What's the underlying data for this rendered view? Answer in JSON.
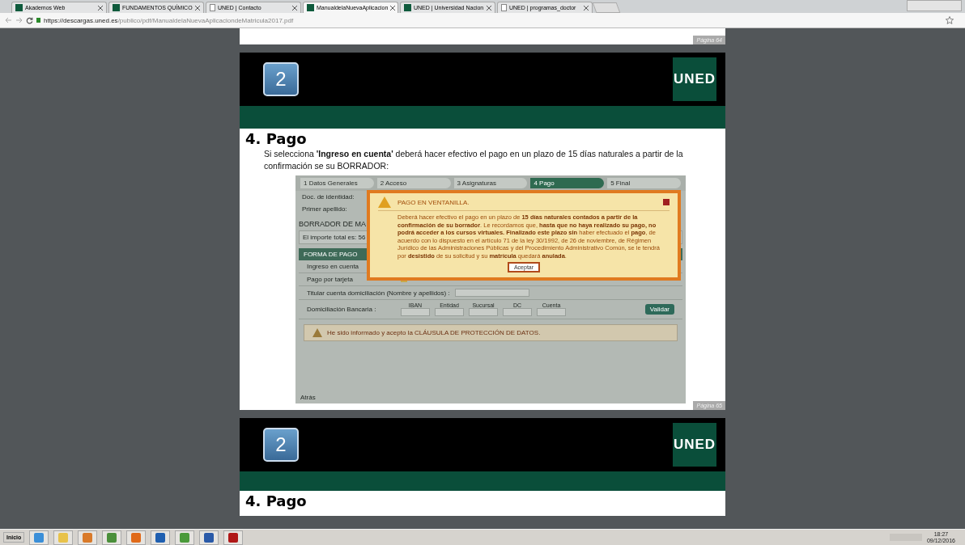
{
  "tabs": [
    {
      "label": "Akademos Web",
      "selected": false,
      "kind": "site"
    },
    {
      "label": "FUNDAMENTOS QUÍMICO",
      "selected": false,
      "kind": "site"
    },
    {
      "label": "UNED | Contacto",
      "selected": false,
      "kind": "page"
    },
    {
      "label": "ManualdelaNuevaAplicacion",
      "selected": true,
      "kind": "site"
    },
    {
      "label": "UNED | Universidad Nacion",
      "selected": false,
      "kind": "site"
    },
    {
      "label": "UNED | programas_doctor",
      "selected": false,
      "kind": "page"
    }
  ],
  "address": {
    "host": "https://descargas.uned.es",
    "path": "/publico/pdf/ManualdelaNuevaAplicaciondeMatricula2017.pdf"
  },
  "pdf": {
    "prev_page_label": "Página 64",
    "page": {
      "number_badge": "2",
      "logo": "UNED",
      "heading": "4. Pago",
      "paragraph": "Si selecciona **'Ingreso en cuenta'** deberá hacer efectivo el pago en un plazo de 15 días naturales a partir de la confirmación se su BORRADOR:",
      "page_label": "Página 65",
      "figure": {
        "steps": [
          {
            "label": "1 Datos Generales",
            "selected": false
          },
          {
            "label": "2 Acceso",
            "selected": false
          },
          {
            "label": "3 Asignaturas",
            "selected": false
          },
          {
            "label": "4 Pago",
            "selected": true
          },
          {
            "label": "5 Final",
            "selected": false
          }
        ],
        "fields": [
          "Doc. de identidad:",
          "Primer apellido:"
        ],
        "section_title": "BORRADOR DE MA",
        "total": "El importe total es: 56",
        "pay_header": "FORMA DE PAGO",
        "pay_options": [
          "Ingreso en cuenta",
          "Pago por tarjeta"
        ],
        "holder_label": "Titular cuenta domiciliación (Nombre y apellidos) :",
        "bank_label": "Domiciliación Bancaria :",
        "bank_parts": [
          "IBAN",
          "Entidad",
          "Sucursal",
          "DC",
          "Cuenta"
        ],
        "validate_button": "Validar",
        "consent": "He sido informado y acepto la CLÁUSULA DE PROTECCIÓN DE DATOS.",
        "back": "Atrás",
        "dialog": {
          "title": "PAGO EN VENTANILLA.",
          "text": "Deberá hacer efectivo el pago en un plazo de **15 días naturales contados a partir de la confirmación de su borrador**. Le recordamos que, **hasta que no haya realizado su pago, no podrá acceder a los cursos virtuales. Finalizado este plazo sin** haber efectuado el **pago**, de acuerdo con lo dispuesto en el artículo 71 de la ley 30/1992, de 26 de noviembre, de Régimen Jurídico de las Administraciones Públicas y del Procedimiento Administrativo Común, se le tendrá por **desistido** de su solicitud y su **matrícula** quedará **anulada**.",
          "button": "Aceptar"
        }
      }
    },
    "next_page": {
      "number_badge": "2",
      "logo": "UNED",
      "heading": "4. Pago"
    }
  },
  "taskbar": {
    "start": "Inicio",
    "time": "18:27",
    "date": "09/12/2016"
  }
}
